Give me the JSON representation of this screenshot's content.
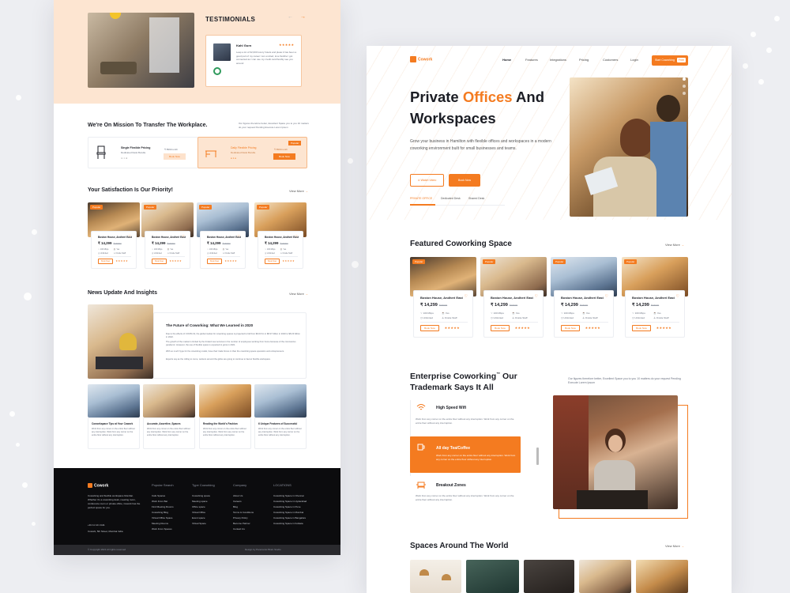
{
  "left": {
    "testimonials": {
      "title": "TESTIMONIALS",
      "name": "Kahl Gurn",
      "stars": "★★★★★",
      "text": "Leap a lot of 62,000 luxury hotels and pleas it has been a good part of my career I am excited, love flexible I got connected as I can use my credit card flexibly see you around",
      "prev": "←",
      "next": "→"
    },
    "mission": {
      "title": "We're On Mission To Transfer The Workplace.",
      "desc": "Our figures therefore better, Excellent Space you to you 10 matters do your request Pending Execute Lorem Ipsum",
      "card1": {
        "title": "Single Flexible Pricing",
        "sub": "Dedicated Desk Bundle",
        "price": "₹ 899/month",
        "btn": "Book Now"
      },
      "card2": {
        "title": "Daily Flexible Pricing",
        "sub": "Dedicated Desk Bundle",
        "price": "₹ 899/month",
        "badge": "Popular",
        "btn": "Book Now"
      }
    },
    "satisfaction": {
      "title": "Your Satisfaction Is Our Priority!",
      "view": "View More"
    },
    "news": {
      "title": "News Update And Insights",
      "view": "View More",
      "main_title": "The Future of Coworking: What We Learned in 2020",
      "p1": "Due to the effects of COVID-19, the global market for coworking spaces is projected to fall from $9.03 bn in $8.37 billion in 2020 to $8.23 billion in 2022.",
      "p2": "The growth of the market is limited by the limited new services in the number of employees working from home because of the coronavirus pandemic. However, the use of flexible space is expected to grow in 2021.",
      "p3": "With so much hype for the coworking model, have their trade forces in than the coworking space operators and entrepreneurs.",
      "p4": "Experts say as the rolling to come, workers around the globe are going to continue to favour flexible workspace.",
      "posts": [
        {
          "title": "Coworkspace Tips at Your Cowork",
          "text": "Work from any corner on the entire floor without any interruption. Work from any corner on the entire floor without any interruption."
        },
        {
          "title": "Accurate, Assertive, Spaces",
          "text": "Work from any corner on the entire floor without any interruption. Work from any corner on the entire floor without any interruption."
        },
        {
          "title": "Reading the World's Fashion",
          "text": "Work from any corner on the entire floor without any interruption. Work from any corner on the entire floor without any interruption."
        },
        {
          "title": "6 Unique Features of Successful",
          "text": "Work from any corner on the entire floor without any interruption. Work from any corner on the entire floor without any interruption."
        }
      ]
    },
    "footer": {
      "brand": "Cowork",
      "about": "Coworking and flexible workspace Mumbai. Whether it's a coworking desk, meeting room, conference room or private office, Cowork has the perfect space for you.",
      "phone": "+91 11 121 1111",
      "address": "Cowork, 5th Street, Mumbai India",
      "cols": [
        {
          "title": "Popular Search",
          "items": [
            "Cafe Spaces",
            "Work From Bar",
            "Find Meeting Rooms",
            "Coworking Blog",
            "Virtual Office Space",
            "Meeting Rooms",
            "Work From Spaces"
          ]
        },
        {
          "title": "Type Coworking",
          "items": [
            "Coworking space",
            "Meeting space",
            "Office space",
            "Virtual Office",
            "Event space",
            "Virtual Space"
          ]
        },
        {
          "title": "Company",
          "items": [
            "About Us",
            "Careers",
            "Blog",
            "Terms & Conditions",
            "Privacy Policy",
            "Become Partner",
            "Contact Us"
          ]
        },
        {
          "title": "LOCATIONS",
          "items": [
            "Coworking Space in Chennai",
            "Coworking Space in Hyderabad",
            "Coworking Space in Pune",
            "Coworking Space in Mumbai",
            "Coworking Space in Bangalore",
            "Coworking Space in Kolkata"
          ]
        }
      ],
      "copyright": "© Copyright 2021 All rights reserved",
      "credit": "Design by Panoramic Brain Studio"
    }
  },
  "right": {
    "nav": {
      "brand": "Cowork",
      "items": [
        "Home",
        "Features",
        "Integrations",
        "Pricing",
        "Customers",
        "Login"
      ],
      "cta": "Start Coworking",
      "cta_badge": "Free"
    },
    "hero": {
      "title1": "Private ",
      "title_accent": "Offices",
      "title2": " And",
      "title3": "Workspaces",
      "desc": "Grow your business in Hamilton with flexible offices and workspaces in a modern coworking environment built for small businesses and teams.",
      "watch": "Watch Video",
      "book": "Book Now",
      "tabs": [
        "PRIVATE OFFICE",
        "Dedicated Desk",
        "Shared Desk"
      ]
    },
    "featured": {
      "title": "Featured Coworking Space",
      "view": "View More"
    },
    "enterprise": {
      "title1": "Enterprise Coworking",
      "tm": "™",
      "title1b": " Our",
      "title2": "Trademark Says It All",
      "desc": "Our figures therefore better, Excellent Space you to you 10 matters do your request Pending Execute Lorem Ipsum",
      "features": [
        {
          "title": "High Speed Wifi",
          "text": "Work from any corner on the entire floor without any interruption. Work from any corner on the entire floor without any interruption."
        },
        {
          "title": "All day Tea/Coffee",
          "text": "Work from any corner on the entire floor without any interruption. Work from any corner on the entire floor without any interruption."
        },
        {
          "title": "Breakout Zones",
          "text": "Work from any corner on the entire floor without any interruption. Work from any corner on the entire floor without any interruption."
        }
      ]
    },
    "spaces": {
      "title": "Spaces Around The World",
      "view": "View More"
    }
  },
  "listing": {
    "tag": "Popular",
    "title": "Boston House, Andheri East",
    "price": "₹ 14,299",
    "old": "₹18000",
    "f1": "100 Mbps",
    "f2": "Yes",
    "f3": "Unlimited",
    "f4": "Onsite Staff",
    "btn": "Book Now",
    "stars": "★★★★★"
  },
  "colors": {
    "accent": "#f47b20",
    "dark": "#111111",
    "peach": "#fde2cc"
  }
}
